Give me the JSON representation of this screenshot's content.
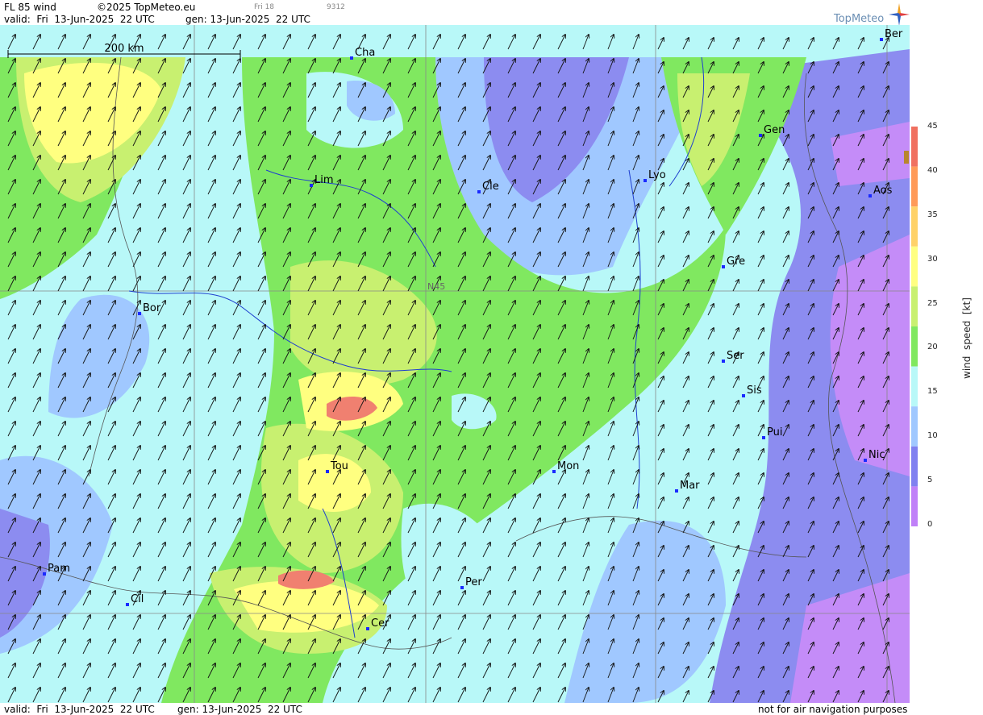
{
  "header": {
    "product": "FL 85 wind",
    "copyright": "©2025 TopMeteo.eu",
    "next_time": "Fri 18",
    "code": "9312",
    "valid": "valid:  Fri  13-Jun-2025  22 UTC",
    "gen": "gen: 13-Jun-2025  22 UTC"
  },
  "logo": {
    "text": "TopMeteo"
  },
  "scale_bar": {
    "label": "200 km"
  },
  "grid_label": "N45",
  "cities": [
    {
      "label": "Cha"
    },
    {
      "label": "Ber"
    },
    {
      "label": "Gen"
    },
    {
      "label": "Lim"
    },
    {
      "label": "Cle"
    },
    {
      "label": "Lyo"
    },
    {
      "label": "Aos"
    },
    {
      "label": "Gre"
    },
    {
      "label": "Bor"
    },
    {
      "label": "Ser"
    },
    {
      "label": "Sis"
    },
    {
      "label": "Pui"
    },
    {
      "label": "Tou"
    },
    {
      "label": "Mon"
    },
    {
      "label": "Nic"
    },
    {
      "label": "Mar"
    },
    {
      "label": "Pam"
    },
    {
      "label": "Per"
    },
    {
      "label": "Cil"
    },
    {
      "label": "Cer"
    }
  ],
  "legend": {
    "title": "wind  speed  [kt]",
    "ticks": [
      "45",
      "40",
      "35",
      "30",
      "25",
      "20",
      "15",
      "10",
      "5",
      "0"
    ],
    "colors": [
      "#f07060",
      "#ff9a58",
      "#ffd268",
      "#ffff80",
      "#c8f070",
      "#80e860",
      "#b8f8f8",
      "#a0c8ff",
      "#8080f0",
      "#c080f8"
    ]
  },
  "footer": {
    "valid": "valid:  Fri  13-Jun-2025  22 UTC",
    "gen": "gen: 13-Jun-2025  22 UTC",
    "disclaimer": "not for air navigation purposes"
  },
  "colors": {
    "lavender": "#c48cf8",
    "purple": "#8c8cf0",
    "blue": "#a0c8ff",
    "cyan": "#b8f8f8",
    "green": "#80e860",
    "yellowgreen": "#c8f070",
    "yellow": "#ffff80",
    "orange": "#ffd268",
    "salmon": "#f08070"
  }
}
